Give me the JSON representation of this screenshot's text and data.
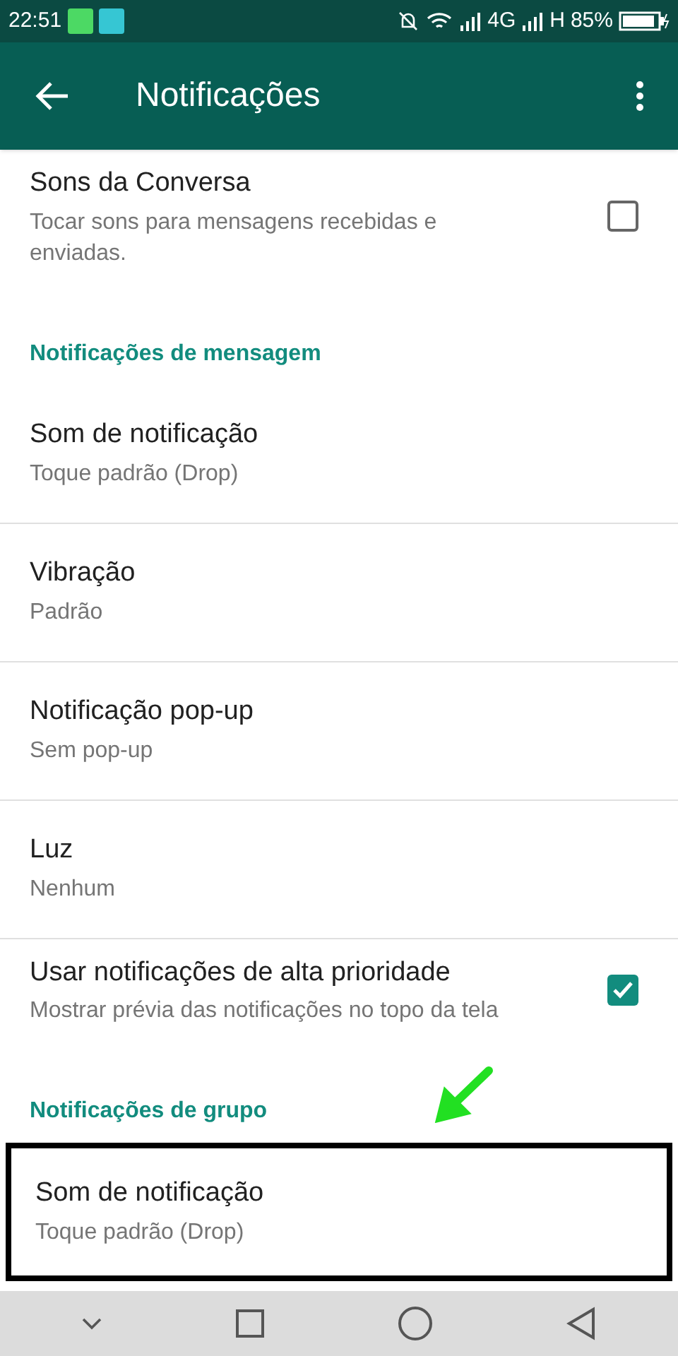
{
  "status_bar": {
    "time": "22:51",
    "network_1": "4G",
    "network_2": "H",
    "battery": "85%"
  },
  "app_bar": {
    "title": "Notificações"
  },
  "items": [
    {
      "kind": "checkbox",
      "title": "Sons da Conversa",
      "subtitle": "Tocar sons para mensagens recebidas e enviadas.",
      "checked": false,
      "highlighted": false
    },
    {
      "kind": "header",
      "title": "Notificações de mensagem"
    },
    {
      "kind": "setting",
      "title": "Som de notificação",
      "subtitle": "Toque padrão (Drop)",
      "highlighted": false
    },
    {
      "kind": "setting",
      "title": "Vibração",
      "subtitle": "Padrão",
      "highlighted": false
    },
    {
      "kind": "setting",
      "title": "Notificação pop-up",
      "subtitle": "Sem pop-up",
      "highlighted": false
    },
    {
      "kind": "setting",
      "title": "Luz",
      "subtitle": "Nenhum",
      "highlighted": false
    },
    {
      "kind": "checkbox",
      "title": "Usar notificações de alta prioridade",
      "subtitle": "Mostrar prévia das notificações no topo da tela",
      "checked": true,
      "highlighted": false
    },
    {
      "kind": "header",
      "title": "Notificações de grupo",
      "arrow": true
    },
    {
      "kind": "setting",
      "title": "Som de notificação",
      "subtitle": "Toque padrão (Drop)",
      "highlighted": true
    }
  ]
}
